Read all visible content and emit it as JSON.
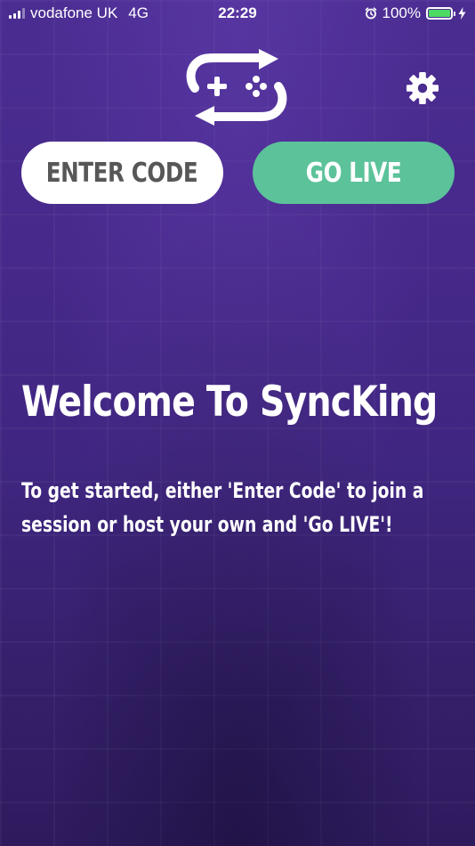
{
  "status_bar": {
    "carrier": "vodafone UK",
    "network": "4G",
    "time": "22:29",
    "battery_percent": "100%",
    "battery_level": 1.0
  },
  "header": {
    "logo_icon": "sync-gamepad-logo",
    "settings_icon": "gear-icon"
  },
  "buttons": {
    "enter_code": "ENTER CODE",
    "go_live": "GO LIVE"
  },
  "welcome": {
    "title": "Welcome To SyncKing",
    "body": "To get started, either 'Enter Code' to join a session or host your own and 'Go LIVE'!"
  },
  "colors": {
    "background": "#46298a",
    "go_live": "#5cc29a",
    "enter_code_bg": "#ffffff",
    "enter_code_text": "#575757"
  }
}
